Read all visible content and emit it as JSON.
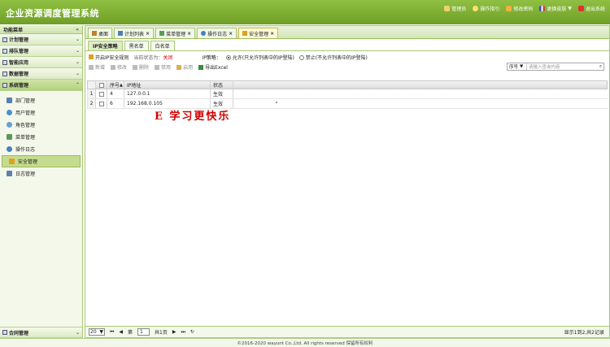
{
  "header": {
    "title": "企业资源调度管理系统",
    "links": [
      {
        "label": "管理员",
        "icon": "user-icon",
        "color": "#f0d070"
      },
      {
        "label": "操作指引",
        "icon": "bulb-icon",
        "color": "#ffe070"
      },
      {
        "label": "修改密码",
        "icon": "key-icon",
        "color": "#f0b040"
      },
      {
        "label": "更换皮肤",
        "icon": "flag-icon",
        "color": "#d04040"
      },
      {
        "label": "退出系统",
        "icon": "exit-icon",
        "color": "#e03030"
      }
    ]
  },
  "sidebar": {
    "title": "功能菜单",
    "groups": [
      {
        "label": "计划管理"
      },
      {
        "label": "排队管理"
      },
      {
        "label": "智能应用"
      },
      {
        "label": "数据管理"
      },
      {
        "label": "系统管理"
      }
    ],
    "sub_items": [
      {
        "label": "部门管理",
        "icon": "department-icon",
        "color": "#5a7fb0"
      },
      {
        "label": "用户管理",
        "icon": "users-icon",
        "color": "#4a90d0"
      },
      {
        "label": "角色管理",
        "icon": "role-icon",
        "color": "#6aa0d0"
      },
      {
        "label": "菜单管理",
        "icon": "menu-tree-icon",
        "color": "#5a9a5a"
      },
      {
        "label": "操作日志",
        "icon": "log-icon",
        "color": "#4a80c0"
      },
      {
        "label": "安全管理",
        "icon": "lock-icon",
        "color": "#e0a020"
      },
      {
        "label": "日志管理",
        "icon": "doc-icon",
        "color": "#6080b0"
      }
    ],
    "bottom_group": {
      "label": "合同管理"
    }
  },
  "tabs": [
    {
      "label": "桌面",
      "icon": "home-icon",
      "color": "#c08030"
    },
    {
      "label": "计划列表",
      "icon": "list-icon",
      "color": "#5080b0"
    },
    {
      "label": "菜单管理",
      "icon": "menu-tree-icon",
      "color": "#5a9a5a"
    },
    {
      "label": "操作日志",
      "icon": "log-icon",
      "color": "#4a80c0"
    },
    {
      "label": "安全管理",
      "icon": "lock-icon",
      "color": "#e0a020"
    }
  ],
  "subtabs": [
    "IP安全策略",
    "黑名单",
    "白名单"
  ],
  "policy": {
    "toggle_label": "开启IP安全规则",
    "status_label": "当前状态为：",
    "status_value": "关闭",
    "strategy_label": "IP策略：",
    "option_allow": "允许(只允许列表中的IP登陆)",
    "option_deny": "禁止(不允许列表中的IP登陆)"
  },
  "toolbar": {
    "add": "新增",
    "edit": "修改",
    "delete": "删除",
    "disable": "禁用",
    "enable": "启用",
    "export": "导出Excel"
  },
  "search": {
    "field": "序号",
    "placeholder": "请输入查询内容"
  },
  "grid": {
    "columns": {
      "seq": "序号",
      "ip": "IP地址",
      "status": "状态"
    },
    "rows": [
      {
        "num": "1",
        "seq": "4",
        "ip": "127.0.0.1",
        "status": "生效"
      },
      {
        "num": "2",
        "seq": "6",
        "ip": "192.168.0.105",
        "status": "生效"
      }
    ]
  },
  "watermark": "E 学习更快乐",
  "pager": {
    "page_size": "20",
    "page_prefix": "第",
    "page": "1",
    "page_suffix": "共1页",
    "info": "显示1到2,共2记录"
  },
  "footer": "©2016-2020 wayunt Co.,Ltd. All rights reserved 保留所有权利"
}
